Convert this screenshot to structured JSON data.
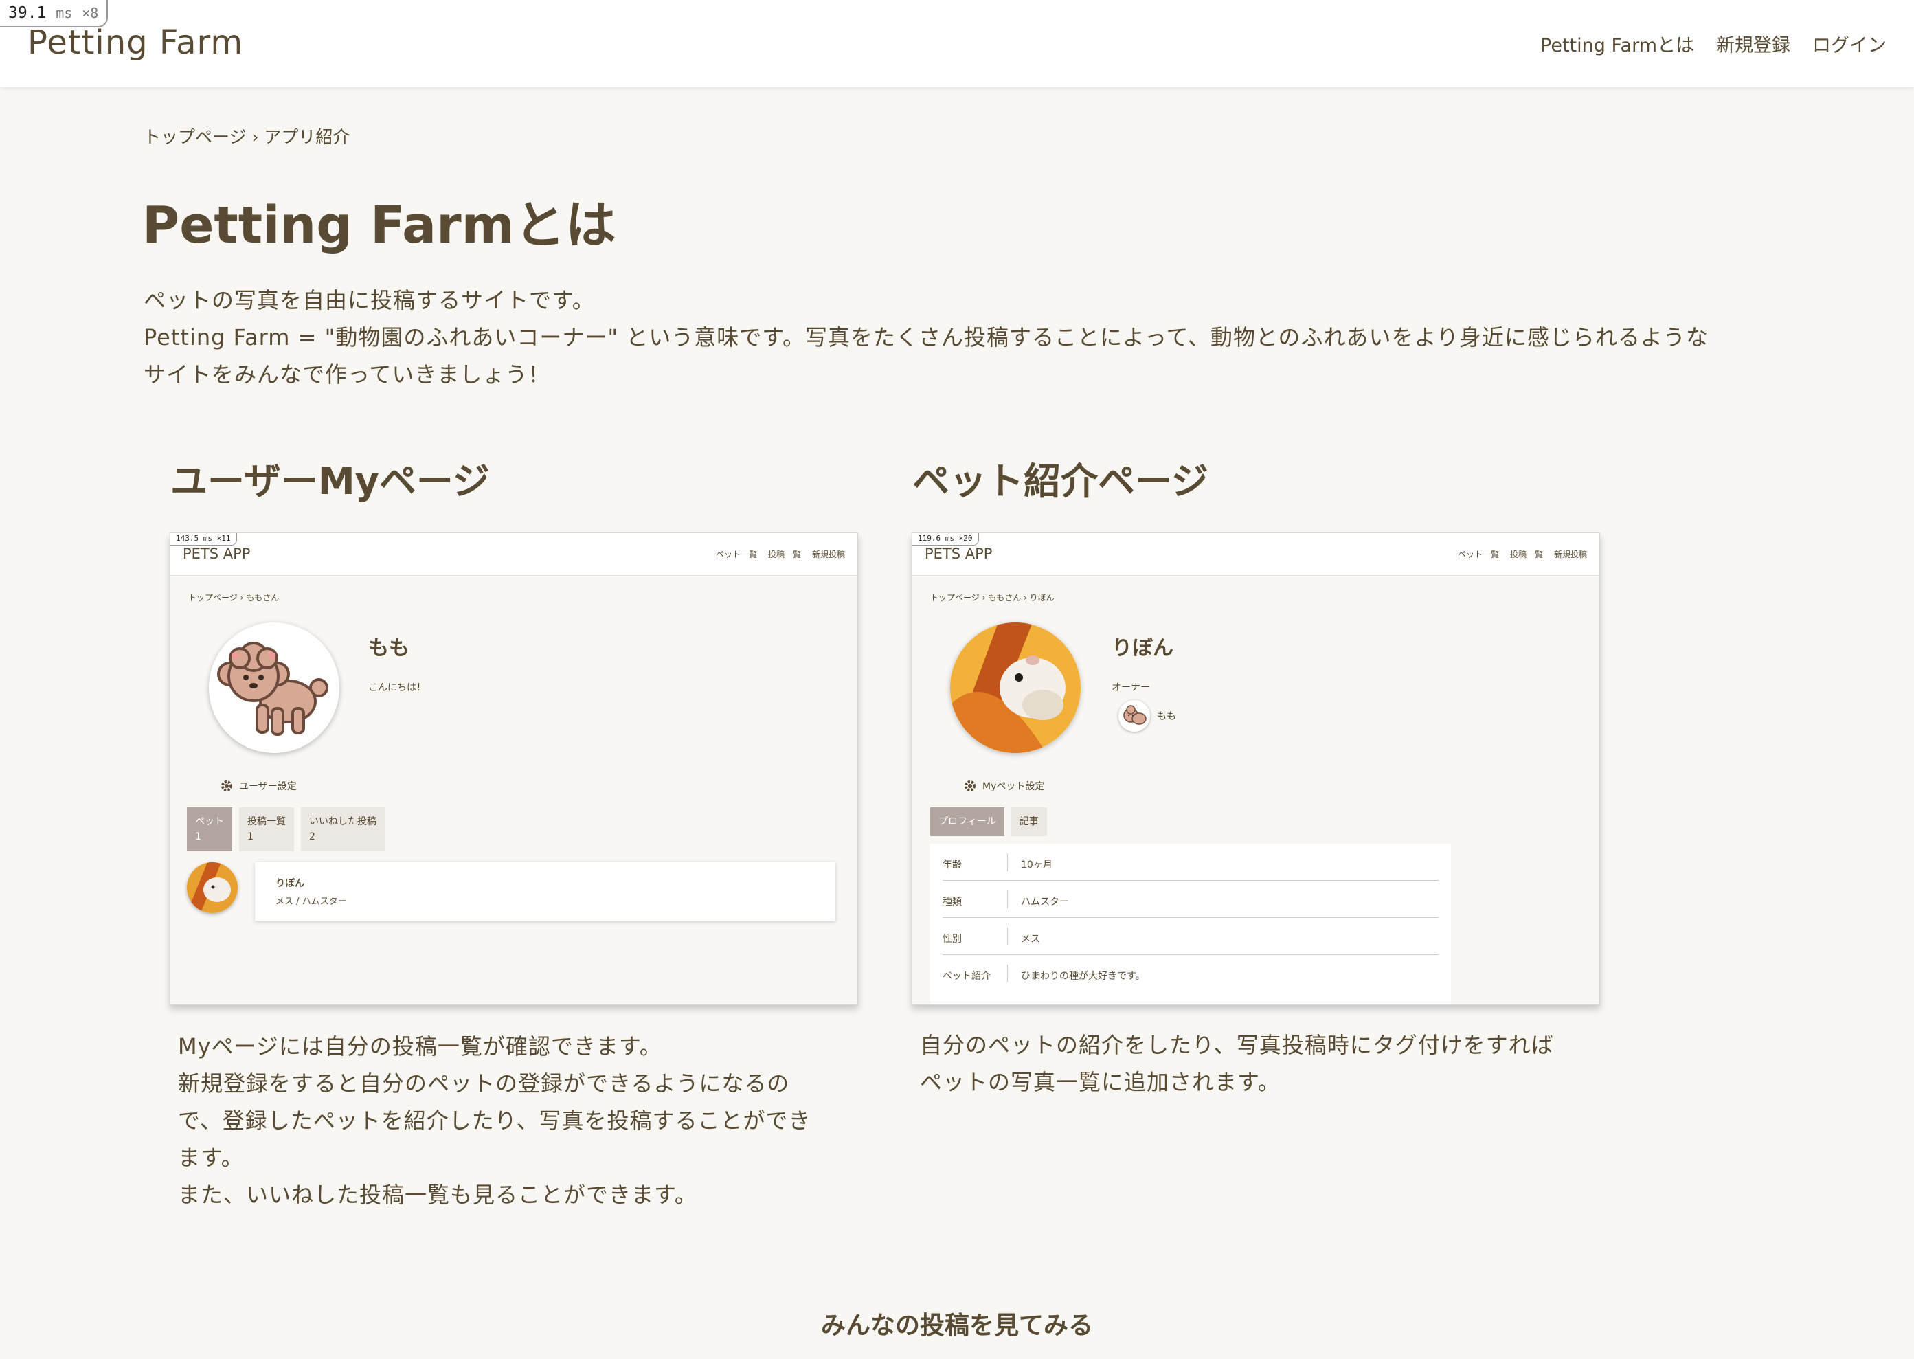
{
  "perf": {
    "value": "39.1",
    "unit": "ms",
    "mult": "×8"
  },
  "header": {
    "brand": "Petting Farm",
    "nav": [
      "Petting Farmとは",
      "新規登録",
      "ログイン"
    ]
  },
  "breadcrumb": "トップページ › アプリ紹介",
  "page_title": "Petting Farmとは",
  "intro": [
    "ペットの写真を自由に投稿するサイトです。",
    "Petting Farm = \"動物園のふれあいコーナー\" という意味です。写真をたくさん投稿することによって、動物とのふれあいをより身近に感じられるような",
    "サイトをみんなで作っていきましょう！"
  ],
  "sections": [
    {
      "title": "ユーザーMyページ",
      "shot": {
        "perf": {
          "value": "143.5",
          "unit": "ms",
          "mult": "×11"
        },
        "brand": "PETS APP",
        "nav": [
          "ペット一覧",
          "投稿一覧",
          "新規投稿"
        ],
        "breadcrumb": "トップページ › ももさん",
        "name": "もも",
        "bio": "こんにちは！",
        "settings": "ユーザー設定",
        "tabs": [
          {
            "label": "ペット",
            "count": "1"
          },
          {
            "label": "投稿一覧",
            "count": "1"
          },
          {
            "label": "いいねした投稿",
            "count": "2"
          }
        ],
        "pet_card": {
          "name": "りぼん",
          "sub": "メス / ハムスター"
        }
      },
      "description": [
        "Myページには自分の投稿一覧が確認できます。",
        "新規登録をすると自分のペットの登録ができるようになるの",
        "で、登録したペットを紹介したり、写真を投稿することができ",
        "ます。",
        "また、いいねした投稿一覧も見ることができます。"
      ]
    },
    {
      "title": "ペット紹介ページ",
      "shot": {
        "perf": {
          "value": "119.6",
          "unit": "ms",
          "mult": "×20"
        },
        "brand": "PETS APP",
        "nav": [
          "ペット一覧",
          "投稿一覧",
          "新規投稿"
        ],
        "breadcrumb": "トップページ › ももさん › りぼん",
        "name": "りぼん",
        "owner_label": "オーナー",
        "owner_name": "もも",
        "settings": "Myペット設定",
        "tabs": [
          {
            "label": "プロフィール"
          },
          {
            "label": "記事"
          }
        ],
        "profile": [
          {
            "key": "年齢",
            "value": "10ヶ月"
          },
          {
            "key": "種類",
            "value": "ハムスター"
          },
          {
            "key": "性別",
            "value": "メス"
          },
          {
            "key": "ペット紹介",
            "value": "ひまわりの種が大好きです。"
          }
        ]
      },
      "description": [
        "自分のペットの紹介をしたり、写真投稿時にタグ付けをすれば",
        "ペットの写真一覧に追加されます。"
      ]
    }
  ],
  "footer_link": "みんなの投稿を見てみる",
  "colors": {
    "text": "#594b33",
    "background": "#f8f7f4",
    "active_tab": "#b3a6a0"
  }
}
